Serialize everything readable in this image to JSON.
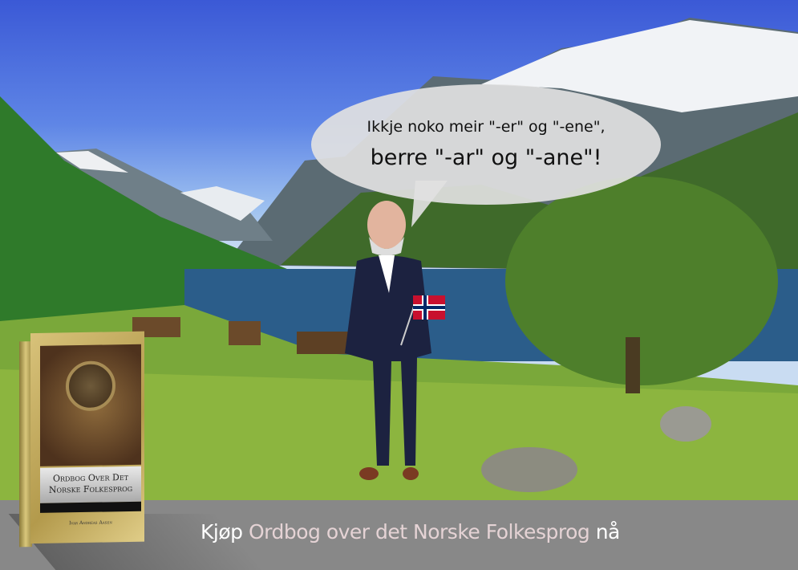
{
  "speech_bubble": {
    "line1": "Ikkje noko meir \"-er\" og \"-ene\",",
    "line2": "berre \"-ar\" og \"-ane\"!"
  },
  "book": {
    "title_line1": "Ordbog Over Det",
    "title_line2": "Norske Folkesprog",
    "author": "Ivar Andreas Aasen"
  },
  "cta": {
    "prefix": "Kjøp",
    "title": "Ordbog over det Norske Folkesprog",
    "suffix": "nå"
  },
  "colors": {
    "banner": "#888888",
    "cta_title": "#e5d3d5",
    "sky": "#3b59d6",
    "flag_red": "#c8102e",
    "flag_blue": "#002868"
  }
}
